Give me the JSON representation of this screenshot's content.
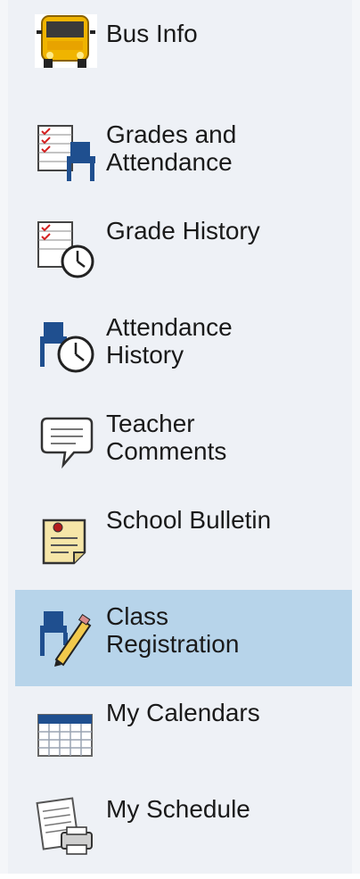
{
  "nav": {
    "items": [
      {
        "label": "Bus Info",
        "icon": "bus-icon",
        "selected": false
      },
      {
        "label": "Grades and\nAttendance",
        "icon": "grades-attendance-icon",
        "selected": false
      },
      {
        "label": "Grade History",
        "icon": "grade-history-icon",
        "selected": false
      },
      {
        "label": "Attendance\nHistory",
        "icon": "attendance-history-icon",
        "selected": false
      },
      {
        "label": "Teacher\nComments",
        "icon": "comment-bubble-icon",
        "selected": false
      },
      {
        "label": "School Bulletin",
        "icon": "bulletin-note-icon",
        "selected": false
      },
      {
        "label": "Class\nRegistration",
        "icon": "class-registration-icon",
        "selected": true
      },
      {
        "label": "My Calendars",
        "icon": "calendar-icon",
        "selected": false
      },
      {
        "label": "My Schedule",
        "icon": "schedule-printer-icon",
        "selected": false
      }
    ]
  },
  "colors": {
    "selected_bg": "#b7d4ea",
    "sidebar_bg": "#eef1f6"
  }
}
